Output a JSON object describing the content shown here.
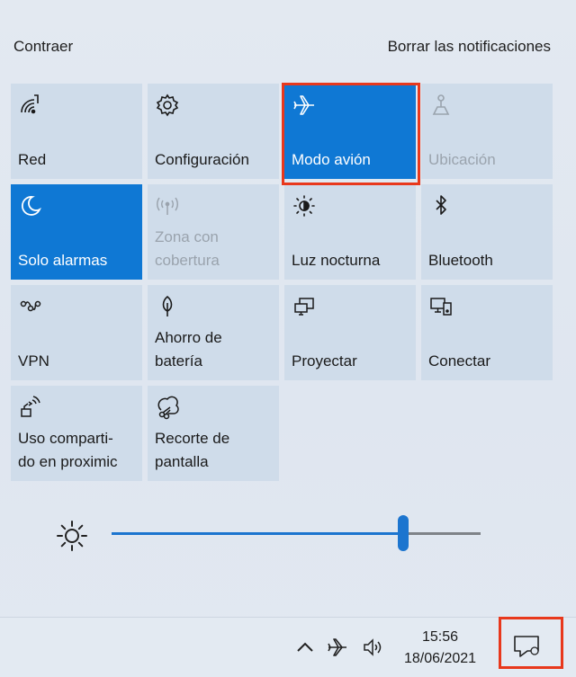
{
  "header": {
    "collapse": "Contraer",
    "clear": "Borrar las notificaciones"
  },
  "tiles": [
    {
      "label": "Red",
      "icon": "network-icon",
      "state": "normal"
    },
    {
      "label": "Configuración",
      "icon": "gear-icon",
      "state": "normal"
    },
    {
      "label": "Modo avión",
      "icon": "airplane-icon",
      "state": "active",
      "highlighted": true
    },
    {
      "label": "Ubicación",
      "icon": "location-icon",
      "state": "disabled"
    },
    {
      "label": "Solo alarmas",
      "icon": "moon-icon",
      "state": "active"
    },
    {
      "label": "Zona con\ncobertura",
      "icon": "hotspot-icon",
      "state": "disabled"
    },
    {
      "label": "Luz nocturna",
      "icon": "night-light-icon",
      "state": "normal"
    },
    {
      "label": "Bluetooth",
      "icon": "bluetooth-icon",
      "state": "normal"
    },
    {
      "label": "VPN",
      "icon": "vpn-icon",
      "state": "normal"
    },
    {
      "label": "Ahorro de\nbatería",
      "icon": "battery-saver-icon",
      "state": "normal"
    },
    {
      "label": "Proyectar",
      "icon": "project-icon",
      "state": "normal"
    },
    {
      "label": "Conectar",
      "icon": "connect-icon",
      "state": "normal"
    },
    {
      "label": "Uso comparti-\ndo en proximic",
      "icon": "nearby-sharing-icon",
      "state": "normal"
    },
    {
      "label": "Recorte de\npantalla",
      "icon": "screen-snip-icon",
      "state": "normal"
    }
  ],
  "brightness": {
    "level": 0.79
  },
  "taskbar": {
    "time": "15:56",
    "date": "18/06/2021",
    "action_center_highlighted": true
  },
  "colors": {
    "accent": "#0f78d4",
    "tile": "#cfdcea",
    "highlight": "#e8381c"
  }
}
